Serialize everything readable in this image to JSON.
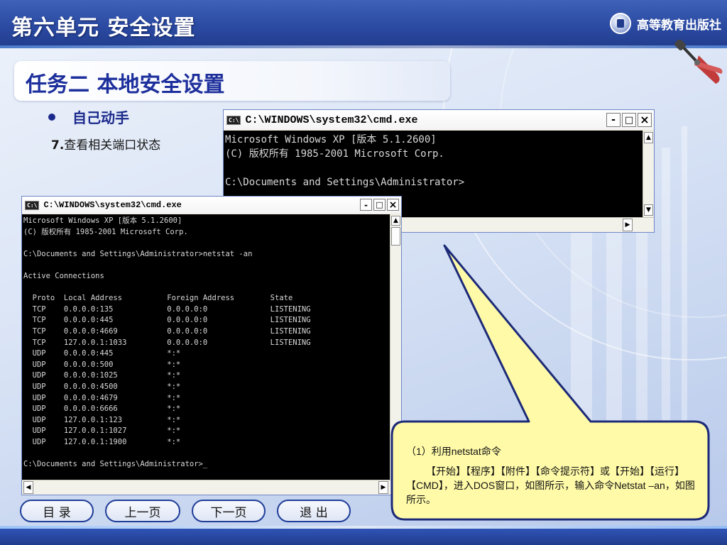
{
  "header": {
    "unit_title": "第六单元 安全设置",
    "publisher": "高等教育出版社",
    "publisher_icon": "publisher-logo-icon",
    "tools_icon": "tools-icon"
  },
  "task": {
    "title": "任务二 本地安全设置",
    "bullet": "自己动手",
    "step_num": "7.",
    "step_text": "查看相关端口状态"
  },
  "cmd_small": {
    "title": "C:\\WINDOWS\\system32\\cmd.exe",
    "lines": [
      "Microsoft Windows XP [版本 5.1.2600]",
      "(C) 版权所有 1985-2001 Microsoft Corp.",
      "",
      "C:\\Documents and Settings\\Administrator>"
    ]
  },
  "cmd_large": {
    "title": "C:\\WINDOWS\\system32\\cmd.exe",
    "lines": [
      "Microsoft Windows XP [版本 5.1.2600]",
      "(C) 版权所有 1985-2001 Microsoft Corp.",
      "",
      "C:\\Documents and Settings\\Administrator>netstat -an",
      "",
      "Active Connections",
      "",
      "  Proto  Local Address          Foreign Address        State",
      "  TCP    0.0.0.0:135            0.0.0.0:0              LISTENING",
      "  TCP    0.0.0.0:445            0.0.0.0:0              LISTENING",
      "  TCP    0.0.0.0:4669           0.0.0.0:0              LISTENING",
      "  TCP    127.0.0.1:1033         0.0.0.0:0              LISTENING",
      "  UDP    0.0.0.0:445            *:*",
      "  UDP    0.0.0.0:500            *:*",
      "  UDP    0.0.0.0:1025           *:*",
      "  UDP    0.0.0.0:4500           *:*",
      "  UDP    0.0.0.0:4679           *:*",
      "  UDP    0.0.0.0:6666           *:*",
      "  UDP    127.0.0.1:123          *:*",
      "  UDP    127.0.0.1:1027         *:*",
      "  UDP    127.0.0.1:1900         *:*",
      "",
      "C:\\Documents and Settings\\Administrator>_"
    ]
  },
  "window_controls": {
    "minimize": "-",
    "maximize": "□",
    "close": "×"
  },
  "callout": {
    "line1": "（1）利用netstat命令",
    "line2": "【开始】【程序】【附件】【命令提示符】或【开始】【运行】【CMD】，进入DOS窗口，如图所示，输入命令Netstat –an，如图所示。",
    "fill_color": "#fffaa8",
    "border_color": "#1c2a78"
  },
  "nav": [
    {
      "id": "toc",
      "label": "目  录"
    },
    {
      "id": "prev",
      "label": "上一页"
    },
    {
      "id": "next",
      "label": "下一页"
    },
    {
      "id": "exit",
      "label": "退  出"
    }
  ],
  "colors": {
    "header": "#2b4aa2",
    "title_blue": "#1d2f9c",
    "terminal_bg": "#000000"
  }
}
